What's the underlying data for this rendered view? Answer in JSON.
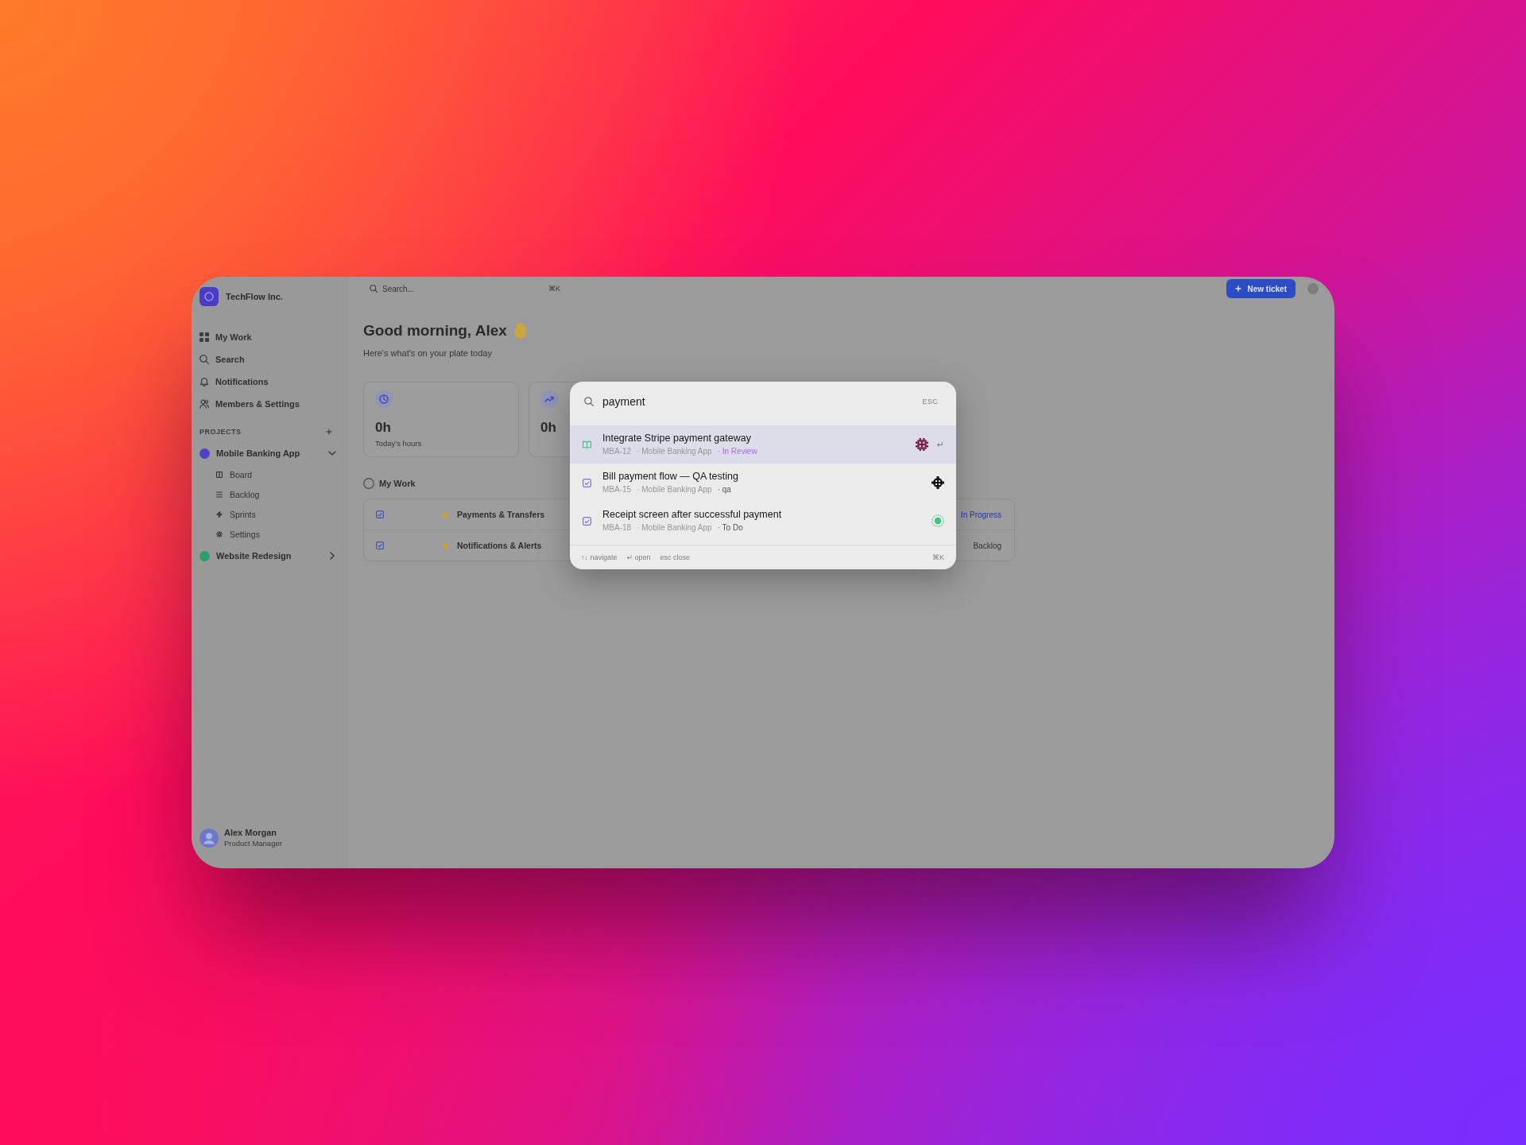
{
  "app": {
    "workspace": {
      "name": "TechFlow Inc."
    },
    "nav": [
      {
        "kind": "grid",
        "label": "My Work"
      },
      {
        "kind": "search",
        "label": "Search"
      },
      {
        "kind": "bell",
        "label": "Notifications"
      },
      {
        "kind": "people",
        "label": "Members & Settings"
      }
    ],
    "projects_heading": "PROJECTS",
    "projects": [
      {
        "name": "Mobile Banking App",
        "color": "#5040c8",
        "expanded": true,
        "children": [
          {
            "kind": "board",
            "label": "Board"
          },
          {
            "kind": "backlog",
            "label": "Backlog"
          },
          {
            "kind": "sprints",
            "label": "Sprints"
          },
          {
            "kind": "settings",
            "label": "Settings"
          }
        ]
      },
      {
        "name": "Website Redesign",
        "color": "#2f9e6e",
        "expanded": false
      }
    ],
    "user": {
      "name": "Alex Morgan",
      "role": "Product Manager"
    },
    "topbar": {
      "search_placeholder": "Search...",
      "shortcut": "⌘K",
      "new_button": "New ticket"
    },
    "greeting": "Good morning, Alex",
    "subtitle": "Here's what's on your plate today",
    "stats": [
      {
        "kind": "clock",
        "value": "0h",
        "label": "Today's hours"
      },
      {
        "kind": "trend",
        "value": "0h"
      }
    ],
    "my_work": {
      "title": "My Work",
      "rows": [
        {
          "title": "Payments & Transfers",
          "color": "#c9a236",
          "status": {
            "text": "In Progress",
            "color": "#2236b0"
          }
        },
        {
          "title": "Notifications & Alerts",
          "color": "#c9a236",
          "status": {
            "text": "Backlog",
            "color": "#333333"
          }
        }
      ]
    }
  },
  "palette": {
    "query": "payment",
    "esc": "ESC",
    "results": [
      {
        "kind": "story",
        "title": "Integrate Stripe payment gateway",
        "key": "MBA-12",
        "project": "· Mobile Banking App",
        "tag": {
          "text": "· In Review",
          "color": "#a46cf2"
        },
        "assignee": {
          "kind": "cross",
          "color": "#6e1440"
        },
        "hint": "↵",
        "selected": true
      },
      {
        "kind": "task",
        "title": "Bill payment flow — QA testing",
        "key": "MBA-15",
        "project": "· Mobile Banking App",
        "tag": {
          "text": "· qa",
          "color": "#555555"
        },
        "assignee": {
          "kind": "blob",
          "color": "#151515"
        },
        "selected": false
      },
      {
        "kind": "task",
        "title": "Receipt screen after successful payment",
        "key": "MBA-18",
        "project": "· Mobile Banking App",
        "tag": {
          "text": "· To Do",
          "color": "#555555"
        },
        "assignee": {
          "kind": "ring",
          "color": "#3cc48a"
        },
        "selected": false
      }
    ],
    "footer": {
      "hints": [
        "↑↓ navigate",
        "↵ open",
        "esc close"
      ],
      "shortcut": "⌘K"
    }
  }
}
